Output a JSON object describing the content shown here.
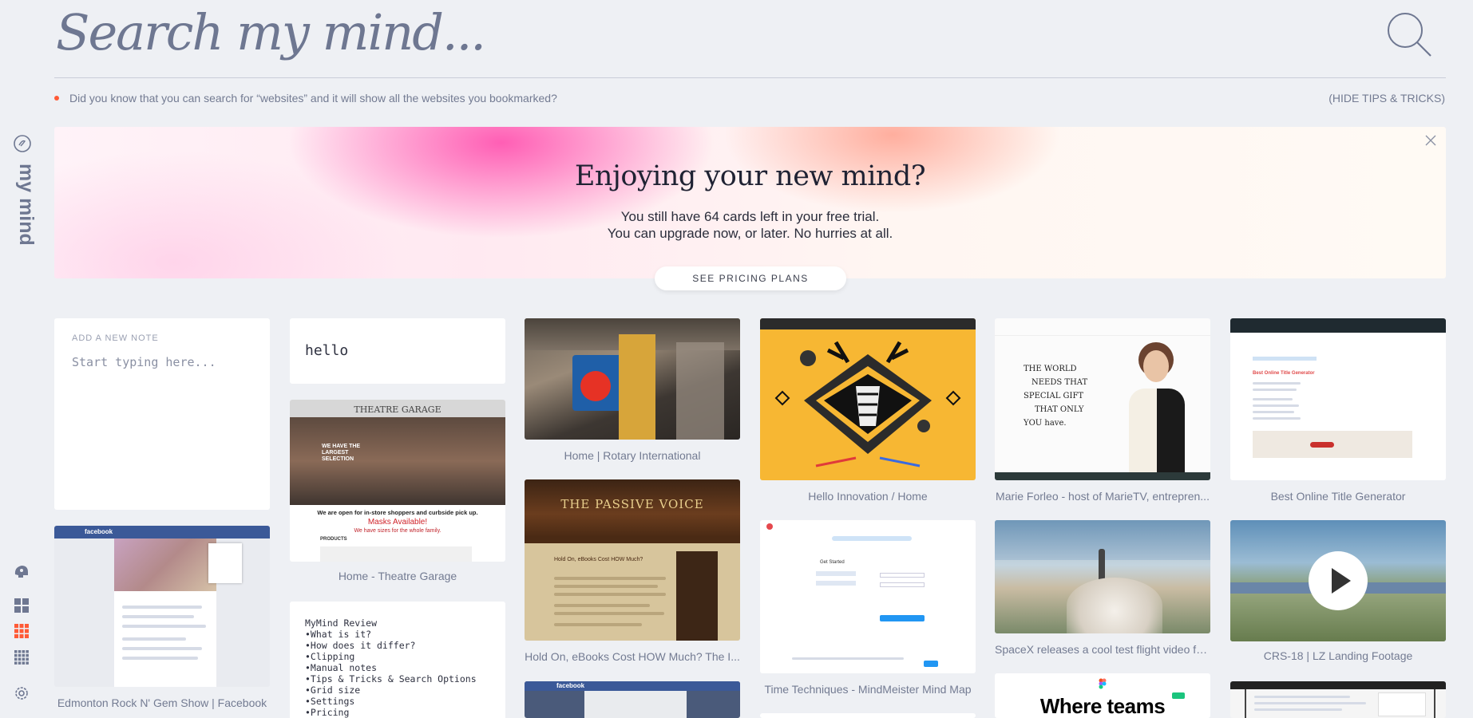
{
  "app": {
    "brand": "my mind",
    "search_placeholder": "Search my mind..."
  },
  "tip": {
    "text": "Did you know that you can search for “websites” and it will show all the websites you bookmarked?",
    "hide_label": "(HIDE TIPS & TRICKS)"
  },
  "banner": {
    "title": "Enjoying your new mind?",
    "line1": "You still have 64 cards left in your free trial.",
    "line2": "You can upgrade now, or later. No hurries at all.",
    "button": "SEE PRICING PLANS"
  },
  "note": {
    "label": "ADD A NEW NOTE",
    "placeholder": "Start typing here..."
  },
  "hello_note": "hello",
  "review_note": {
    "lines": [
      "MyMind Review",
      "•What is it?",
      "•How does it differ?",
      "•Clipping",
      "•Manual notes",
      "•Tips & Tricks & Search Options",
      "•Grid size",
      "•Settings",
      "•Pricing"
    ]
  },
  "thumb_text": {
    "theatre_logo": "THEATRE GARAGE",
    "theatre_big": "WE HAVE THE LARGEST SELECTION",
    "theatre_open": "We are open for in-store shoppers and curbside pick up.",
    "theatre_masks": "Masks Available!",
    "theatre_sizes": "We have sizes for the whole family.",
    "theatre_products": "PRODUCTS",
    "passive_title": "THE PASSIVE VOICE",
    "passive_heading": "Hold On, eBooks Cost HOW Much?",
    "facebook": "facebook",
    "forleo_quote": [
      "THE WORLD",
      "NEEDS THAT",
      "SPECIAL GIFT",
      "THAT ONLY",
      "YOU have."
    ],
    "title_gen_heading": "Best Online Title Generator",
    "mindmeister_heading": "Get Started",
    "figma_text": "Where teams"
  },
  "captions": {
    "facebook": "Edmonton Rock N' Gem Show | Facebook",
    "theatre": "Home - Theatre Garage",
    "rotary": "Home | Rotary International",
    "passive": "Hold On, eBooks Cost HOW Much? The I...",
    "hello_innovation": "Hello Innovation / Home",
    "mindmeister": "Time Techniques - MindMeister Mind Map",
    "forleo": "Marie Forleo - host of MarieTV, entrepren...",
    "spacex": "SpaceX releases a cool test flight video fo...",
    "title_generator": "Best Online Title Generator",
    "crs18": "CRS-18 | LZ Landing Footage"
  },
  "colors": {
    "background": "#eef0f4",
    "accent_orange": "#ff5a36",
    "muted_text": "#737b92",
    "brand_text": "#6e7791"
  },
  "icons": [
    "mind-logo-icon",
    "brain-icon",
    "grid-large-icon",
    "grid-medium-icon",
    "grid-small-icon",
    "settings-icon",
    "search-icon",
    "close-icon",
    "play-icon"
  ]
}
